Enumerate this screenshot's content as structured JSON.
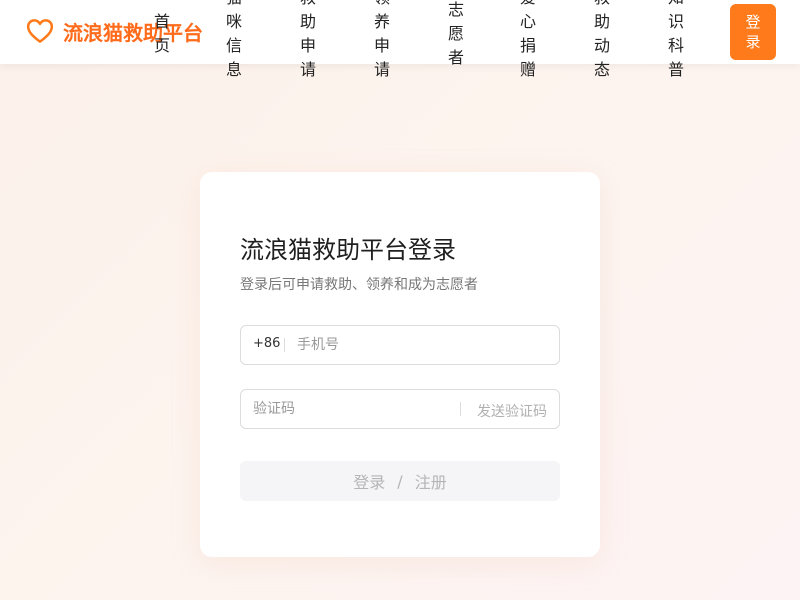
{
  "header": {
    "logo_text": "流浪猫救助平台",
    "nav": [
      {
        "label": "首页"
      },
      {
        "label": "猫咪信息"
      },
      {
        "label": "救助申请"
      },
      {
        "label": "领养申请"
      },
      {
        "label": "志愿者"
      },
      {
        "label": "爱心捐赠"
      },
      {
        "label": "救助动态"
      },
      {
        "label": "知识科普"
      }
    ],
    "login_label": "登录"
  },
  "login": {
    "title": "流浪猫救助平台登录",
    "subtitle": "登录后可申请救助、领养和成为志愿者",
    "phone_prefix": "+86",
    "phone_placeholder": "手机号",
    "code_placeholder": "验证码",
    "send_code_label": "发送验证码",
    "submit_login": "登录",
    "submit_separator": "/",
    "submit_register": "注册"
  },
  "colors": {
    "accent": "#ff7a1a",
    "brand_text": "#ff6b1a"
  },
  "icons": {
    "logo": "heart-icon"
  }
}
